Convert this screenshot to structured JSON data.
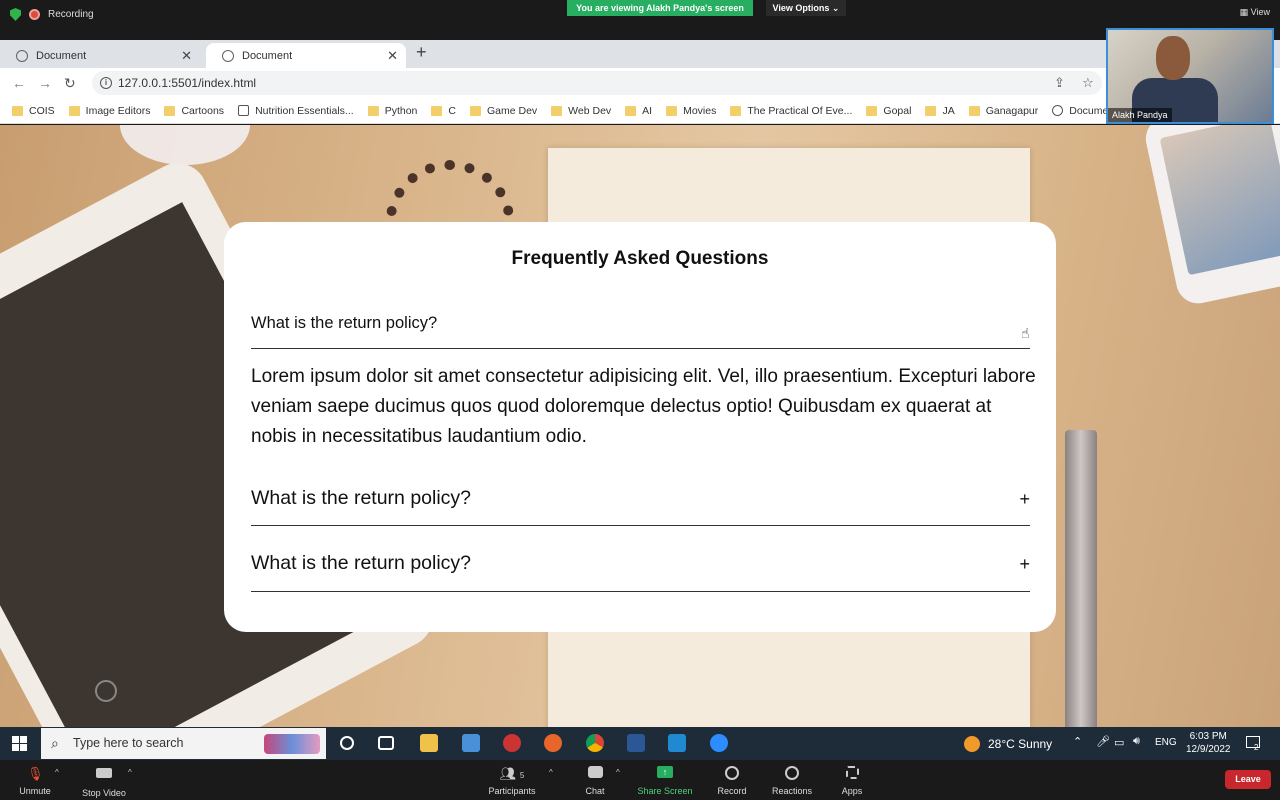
{
  "zoom_top": {
    "recording_label": "Recording",
    "viewing_banner": "You are viewing Alakh Pandya's screen",
    "view_options": "View Options ⌄",
    "view_right": "View"
  },
  "browser": {
    "tabs": [
      {
        "label": "Document"
      },
      {
        "label": "Document"
      }
    ],
    "url": "127.0.0.1:5501/index.html",
    "bookmarks": [
      {
        "label": "COIS",
        "icon": "folder-icon"
      },
      {
        "label": "Image Editors",
        "icon": "folder-icon"
      },
      {
        "label": "Cartoons",
        "icon": "folder-icon"
      },
      {
        "label": "Nutrition Essentials...",
        "icon": "site-icon"
      },
      {
        "label": "Python",
        "icon": "folder-icon"
      },
      {
        "label": "C",
        "icon": "folder-icon"
      },
      {
        "label": "Game Dev",
        "icon": "folder-icon"
      },
      {
        "label": "Web Dev",
        "icon": "folder-icon"
      },
      {
        "label": "AI",
        "icon": "folder-icon"
      },
      {
        "label": "Movies",
        "icon": "folder-icon"
      },
      {
        "label": "The Practical Of Eve...",
        "icon": "folder-icon"
      },
      {
        "label": "Gopal",
        "icon": "folder-icon"
      },
      {
        "label": "JA",
        "icon": "folder-icon"
      },
      {
        "label": "Ganagapur",
        "icon": "folder-icon"
      },
      {
        "label": "Document",
        "icon": "globe-icon"
      }
    ]
  },
  "faq": {
    "title": "Frequently Asked Questions",
    "items": [
      {
        "question": "What is the return policy?",
        "expanded": true,
        "answer": "Lorem ipsum dolor sit amet consectetur adipisicing elit. Vel, illo praesentium. Excepturi labore veniam saepe ducimus quos quod doloremque delectus optio! Quibusdam ex quaerat at nobis in necessitatibus laudantium odio."
      },
      {
        "question": "What is the return policy?",
        "expanded": false,
        "toggle": "+"
      },
      {
        "question": "What is the return policy?",
        "expanded": false,
        "toggle": "+"
      }
    ]
  },
  "video_tile": {
    "name": "Alakh Pandya"
  },
  "taskbar": {
    "search_placeholder": "Type here to search",
    "weather": "28°C  Sunny",
    "language": "ENG",
    "time": "6:03 PM",
    "date": "12/9/2022",
    "notification_count": "2"
  },
  "zoom_bottom": {
    "unmute": "Unmute",
    "stop_video": "Stop Video",
    "participants": "Participants",
    "participants_count": "5",
    "chat": "Chat",
    "share_screen": "Share Screen",
    "record": "Record",
    "reactions": "Reactions",
    "apps": "Apps",
    "leave": "Leave"
  }
}
